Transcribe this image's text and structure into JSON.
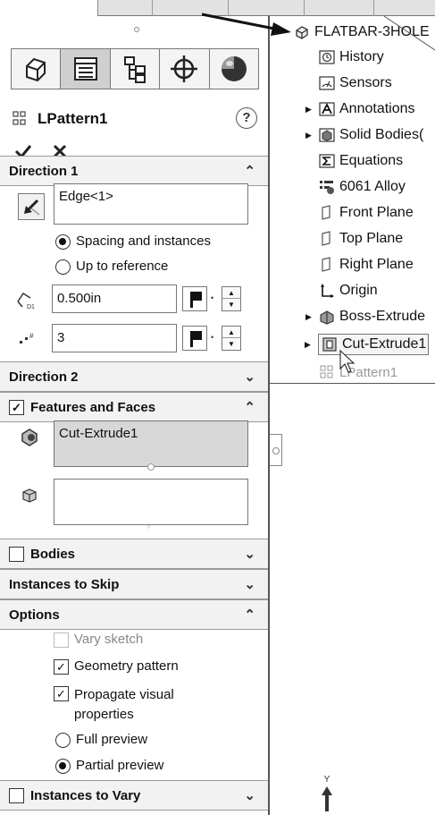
{
  "property_manager": {
    "feature_name": "LPattern1",
    "help_label": "?",
    "ok_icon": "check-icon",
    "cancel_icon": "x-icon",
    "tabs": [
      {
        "name": "feature-manager-tab",
        "icon": "feature-tree-icon"
      },
      {
        "name": "property-manager-tab",
        "icon": "property-manager-icon"
      },
      {
        "name": "configuration-manager-tab",
        "icon": "configuration-icon"
      },
      {
        "name": "dimxpert-tab",
        "icon": "crosshair-icon"
      },
      {
        "name": "display-manager-tab",
        "icon": "appearance-sphere-icon"
      }
    ],
    "direction1": {
      "title": "Direction 1",
      "edge_value": "Edge<1>",
      "option_spacing": "Spacing and instances",
      "option_reference": "Up to reference",
      "spacing_value": "0.500in",
      "instances_value": "3",
      "spacing_icon_label": "D1",
      "instances_icon_label": "#"
    },
    "direction2": {
      "title": "Direction 2"
    },
    "features_faces": {
      "title": "Features and Faces",
      "checked": true,
      "features_list_value": "Cut-Extrude1",
      "faces_list_value": ""
    },
    "bodies": {
      "title": "Bodies",
      "checked": false
    },
    "instances_to_skip": {
      "title": "Instances to Skip"
    },
    "options": {
      "title": "Options",
      "vary_sketch": "Vary sketch",
      "geometry_pattern": "Geometry pattern",
      "propagate_line1": "Propagate visual",
      "propagate_line2": "properties",
      "full_preview": "Full preview",
      "partial_preview": "Partial preview"
    },
    "instances_to_vary": {
      "title": "Instances to Vary",
      "checked": false
    }
  },
  "feature_tree": {
    "root": "FLATBAR-3HOLE",
    "items": [
      {
        "label": "History",
        "icon": "history-icon",
        "expandable": false
      },
      {
        "label": "Sensors",
        "icon": "sensors-icon",
        "expandable": false
      },
      {
        "label": "Annotations",
        "icon": "annotations-icon",
        "expandable": true
      },
      {
        "label": "Solid Bodies(",
        "icon": "solid-bodies-icon",
        "expandable": true
      },
      {
        "label": "Equations",
        "icon": "equations-icon",
        "expandable": false
      },
      {
        "label": "6061 Alloy",
        "icon": "material-icon",
        "expandable": false
      },
      {
        "label": "Front Plane",
        "icon": "plane-icon",
        "expandable": false
      },
      {
        "label": "Top Plane",
        "icon": "plane-icon",
        "expandable": false
      },
      {
        "label": "Right Plane",
        "icon": "plane-icon",
        "expandable": false
      },
      {
        "label": "Origin",
        "icon": "origin-icon",
        "expandable": false
      },
      {
        "label": "Boss-Extrude",
        "icon": "boss-extrude-icon",
        "expandable": true
      },
      {
        "label": "Cut-Extrude1",
        "icon": "cut-extrude-icon",
        "expandable": true
      },
      {
        "label": "LPattern1",
        "icon": "linear-pattern-icon",
        "expandable": false
      }
    ]
  },
  "triad": {
    "axis_label": "Y"
  }
}
